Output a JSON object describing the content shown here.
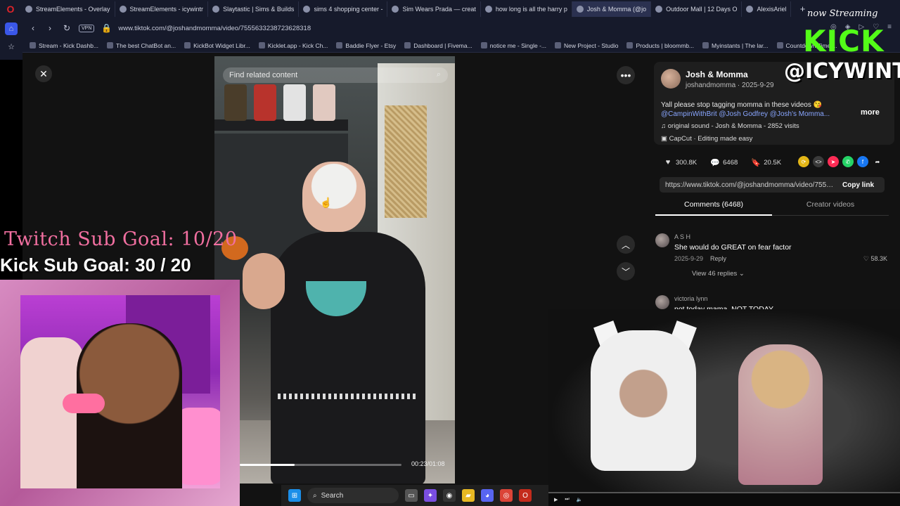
{
  "browser": {
    "tabs": [
      {
        "label": "StreamElements - Overlay",
        "active": false
      },
      {
        "label": "StreamElements - icywintr",
        "active": false
      },
      {
        "label": "Slaytastic | Sims & Builds",
        "active": false
      },
      {
        "label": "sims 4 shopping center -",
        "active": false
      },
      {
        "label": "Sim Wears Prada — creat",
        "active": false
      },
      {
        "label": "how long is all the harry p",
        "active": false
      },
      {
        "label": "Josh & Momma (@jo",
        "active": true
      },
      {
        "label": "Outdoor Mall | 12 Days O",
        "active": false
      },
      {
        "label": "AlexisAriel",
        "active": false
      }
    ],
    "new_tab": "+",
    "vpn": "VPN",
    "url": "www.tiktok.com/@joshandmomma/video/7555633238723628318",
    "bookmarks": [
      "Stream - Kick Dashb...",
      "The best ChatBot an...",
      "KickBot Widget Libr...",
      "Kicklet.app - Kick Ch...",
      "Baddie Flyer - Etsy",
      "Dashboard | Fivema...",
      "notice me - Single -...",
      "New Project - Studio",
      "Products | bloommb...",
      "Myinstants | The lar...",
      "Countdown Timer..."
    ]
  },
  "video": {
    "search_placeholder": "Find related content",
    "time": "00:23/01:08",
    "progress": 0.34
  },
  "post": {
    "author_name": "Josh & Momma",
    "author_meta": "joshandmomma · 2025-9-29",
    "caption": "Yall please stop tagging momma in these videos 😘",
    "tags": "@CampinWithBrit @Josh Godfrey @Josh's Momma...",
    "more": "more",
    "sound": "♫  original sound - Josh & Momma - 2852 visits",
    "capcut": "CapCut · Editing made easy",
    "likes": "300.8K",
    "comments": "6468",
    "saves": "20.5K",
    "link": "https://www.tiktok.com/@joshandmomma/video/7555...",
    "copy_link": "Copy link",
    "tab_comments": "Comments (6468)",
    "tab_creator": "Creator videos"
  },
  "comments": [
    {
      "user": "A S H",
      "text": "She would do GREAT on fear factor",
      "date": "2025-9-29",
      "reply": "Reply",
      "likes": "58.3K",
      "replies": "View 46 replies ⌄"
    },
    {
      "user": "victoria lynn",
      "text": "not today mama, NOT TODAY"
    }
  ],
  "overlay": {
    "twitch_goal": "Twitch Sub Goal: 10/20",
    "kick_goal": "Kick Sub Goal: 30 / 20",
    "brand_script": "now Streaming",
    "brand_logo": "KICK",
    "handle": "@ICYWINTRR"
  },
  "taskbar": {
    "search": "Search"
  }
}
